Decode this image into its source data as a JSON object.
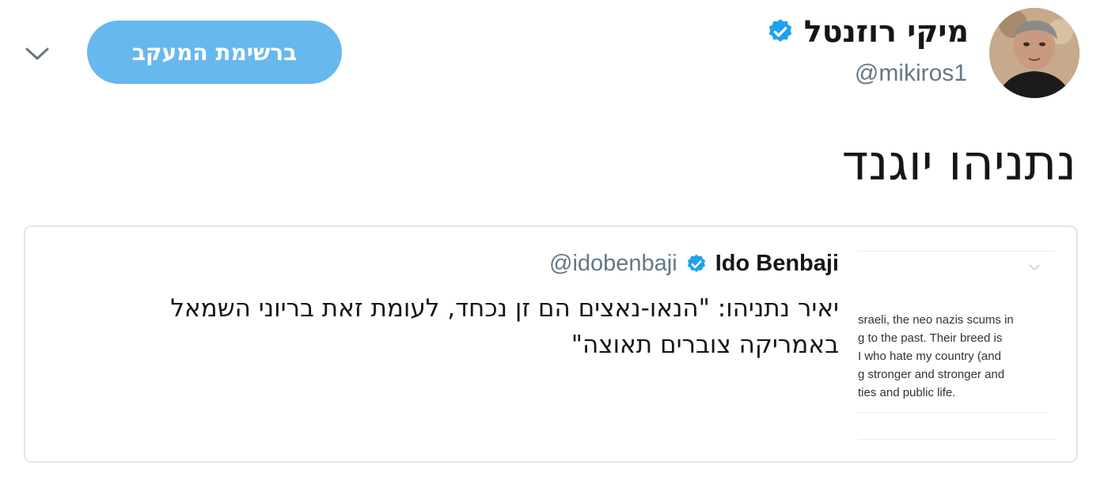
{
  "header": {
    "display_name": "מיקי רוזנטל",
    "handle": "@mikiros1",
    "follow_button_label": "ברשימת המעקב",
    "verified_icon": "verified-badge-icon",
    "avatar_icon": "user-avatar",
    "menu_icon": "chevron-down-icon"
  },
  "tweet": {
    "text": "נתניהו יוגנד"
  },
  "quoted_tweet": {
    "author_name": "Ido Benbaji",
    "author_handle": "@idobenbaji",
    "text_lines": [
      "יאיר נתניהו: \"הנאו-נאצים הם זן נכחד, לעומת זאת בריוני השמאל",
      "באמריקה צוברים תאוצה\""
    ],
    "media_text_lines": [
      "sraeli, the neo nazis scums in",
      "g to the past. Their breed is",
      "I who hate my country (and",
      "g stronger and stronger and",
      "ties and public life."
    ]
  },
  "colors": {
    "accent": "#1da1f2",
    "follow_button": "#67b8ee",
    "secondary_text": "#657786",
    "border": "#e1e8ed"
  }
}
